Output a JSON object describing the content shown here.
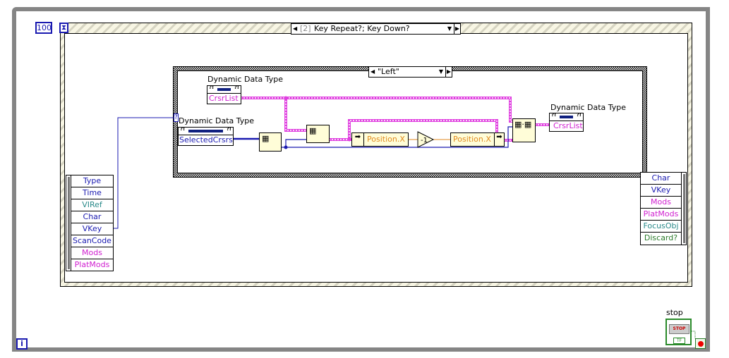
{
  "while_loop": {
    "timeout_constant": "100",
    "iteration_terminal": "i"
  },
  "event_structure": {
    "case_index": "[2]",
    "case_label": "Key Repeat?;  Key Down?"
  },
  "case_structure": {
    "selector": "\"Left\""
  },
  "event_data_left": {
    "items": [
      {
        "label": "Type",
        "color": "#1a1ab0"
      },
      {
        "label": "Time",
        "color": "#1a1ab0"
      },
      {
        "label": "VIRef",
        "color": "#2a8a8a"
      },
      {
        "label": "Char",
        "color": "#1a1ab0"
      },
      {
        "label": "VKey",
        "color": "#1a1ab0"
      },
      {
        "label": "ScanCode",
        "color": "#1a1ab0"
      },
      {
        "label": "Mods",
        "color": "#d020d0"
      },
      {
        "label": "PlatMods",
        "color": "#d020d0"
      }
    ]
  },
  "event_filter_right": {
    "items": [
      {
        "label": "Char",
        "color": "#1a1ab0"
      },
      {
        "label": "VKey",
        "color": "#1a1ab0"
      },
      {
        "label": "Mods",
        "color": "#d020d0"
      },
      {
        "label": "PlatMods",
        "color": "#d020d0"
      },
      {
        "label": "FocusObj",
        "color": "#2a8a8a"
      },
      {
        "label": "Discard?",
        "color": "#2a7a2a"
      }
    ]
  },
  "property_nodes": {
    "crsrlist_read": {
      "class": "Dynamic Data Type",
      "property": "CrsrList"
    },
    "selected_read": {
      "class": "Dynamic Data Type",
      "property": "SelectedCrsrs"
    },
    "crsrlist_write": {
      "class": "Dynamic Data Type",
      "property": "CrsrList"
    }
  },
  "unbundle": {
    "field": "Position.X"
  },
  "bundle": {
    "field": "Position.X"
  },
  "decrement": {
    "label": "-1"
  },
  "stop": {
    "label": "stop",
    "button_text": "STOP",
    "type_text": "TF"
  },
  "colors": {
    "cluster_wire": "#e040e0",
    "int_wire": "#1a1ab0",
    "num_wire": "#e08a20"
  }
}
